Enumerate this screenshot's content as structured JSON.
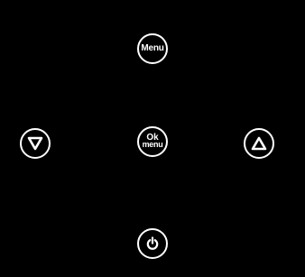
{
  "panel": {
    "background": "#000000",
    "foreground": "#ffffff"
  },
  "buttons": {
    "menu": {
      "label": "Menu"
    },
    "ok_menu": {
      "line1": "Ok",
      "line2": "menu"
    },
    "down": {
      "icon": "triangle-down-icon"
    },
    "up": {
      "icon": "triangle-up-icon"
    },
    "power": {
      "icon": "power-icon"
    }
  }
}
